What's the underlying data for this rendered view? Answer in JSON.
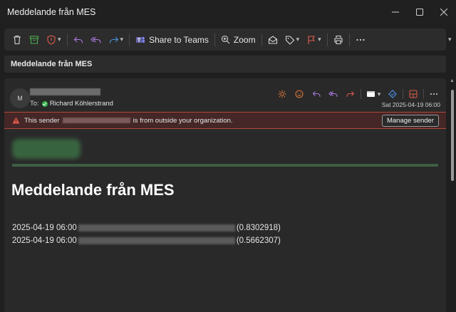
{
  "window": {
    "title": "Meddelande från MES",
    "controls": [
      "minimize",
      "maximize",
      "close"
    ]
  },
  "toolbar": {
    "share_teams_label": "Share to Teams",
    "zoom_label": "Zoom"
  },
  "subject_bar": {
    "subject": "Meddelande från MES"
  },
  "header": {
    "avatar_initial": "M",
    "to_prefix": "To:",
    "recipient": "Richard Köhlerstrand",
    "date": "Sat 2025-04-19 06:00"
  },
  "warning": {
    "prefix": "This sender",
    "suffix": "is from outside your organization.",
    "button_label": "Manage sender"
  },
  "body": {
    "headline": "Meddelande från MES",
    "entries": [
      {
        "timestamp": "2025-04-19 06:00",
        "value": "(0.8302918)"
      },
      {
        "timestamp": "2025-04-19 06:00",
        "value": "(0.5662307)"
      }
    ]
  },
  "colors": {
    "accent_red": "#e05a4a",
    "accent_orange": "#e0793a",
    "accent_purple": "#a979e0",
    "accent_blue": "#4a90e2",
    "teams_purple": "#6264a7",
    "archive_green": "#4caf50",
    "warning_bg": "#442726",
    "status_green": "#34b14a"
  }
}
